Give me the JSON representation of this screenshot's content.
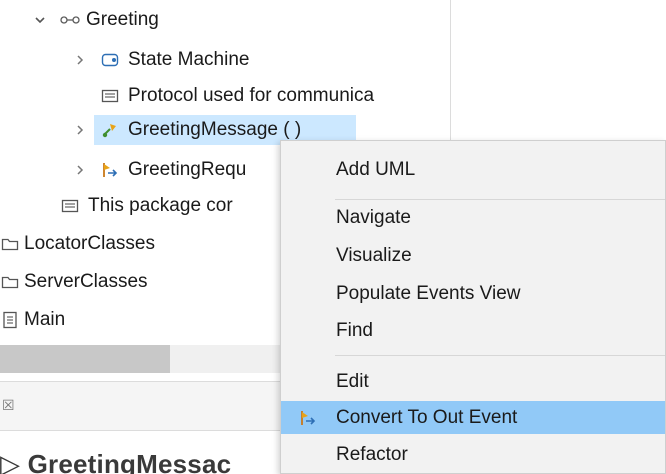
{
  "tree": {
    "items": [
      {
        "label": "Greeting",
        "icon": "protocol-icon",
        "twisty": "expanded"
      },
      {
        "label": "State Machine",
        "icon": "state-machine-icon",
        "twisty": "collapsed"
      },
      {
        "label": "Protocol used for communica",
        "icon": "comment-icon",
        "twisty": "none"
      },
      {
        "label": "GreetingMessage ( )",
        "icon": "message-icon",
        "twisty": "collapsed"
      },
      {
        "label": "GreetingRequ",
        "icon": "in-event-icon",
        "twisty": "collapsed"
      },
      {
        "label": "This package cor",
        "icon": "comment-icon",
        "twisty": "none"
      },
      {
        "label": "LocatorClasses",
        "icon": "folder-icon",
        "twisty": "none"
      },
      {
        "label": "ServerClasses",
        "icon": "folder-icon",
        "twisty": "none"
      },
      {
        "label": "Main",
        "icon": "document-icon",
        "twisty": "none"
      }
    ]
  },
  "editor": {
    "tab_close": "☒",
    "title": "▷ GreetingMessac"
  },
  "context_menu": {
    "items": [
      {
        "label": "Add UML"
      },
      {
        "label": "Navigate"
      },
      {
        "label": "Visualize"
      },
      {
        "label": "Populate Events View"
      },
      {
        "label": "Find"
      },
      {
        "label": "Edit"
      },
      {
        "label": "Convert To Out Event",
        "icon": "out-event-icon"
      },
      {
        "label": "Refactor"
      }
    ]
  },
  "colors": {
    "selection": "#cce8ff",
    "menu_highlight": "#91c9f7",
    "menu_background": "#f2f2f2"
  }
}
